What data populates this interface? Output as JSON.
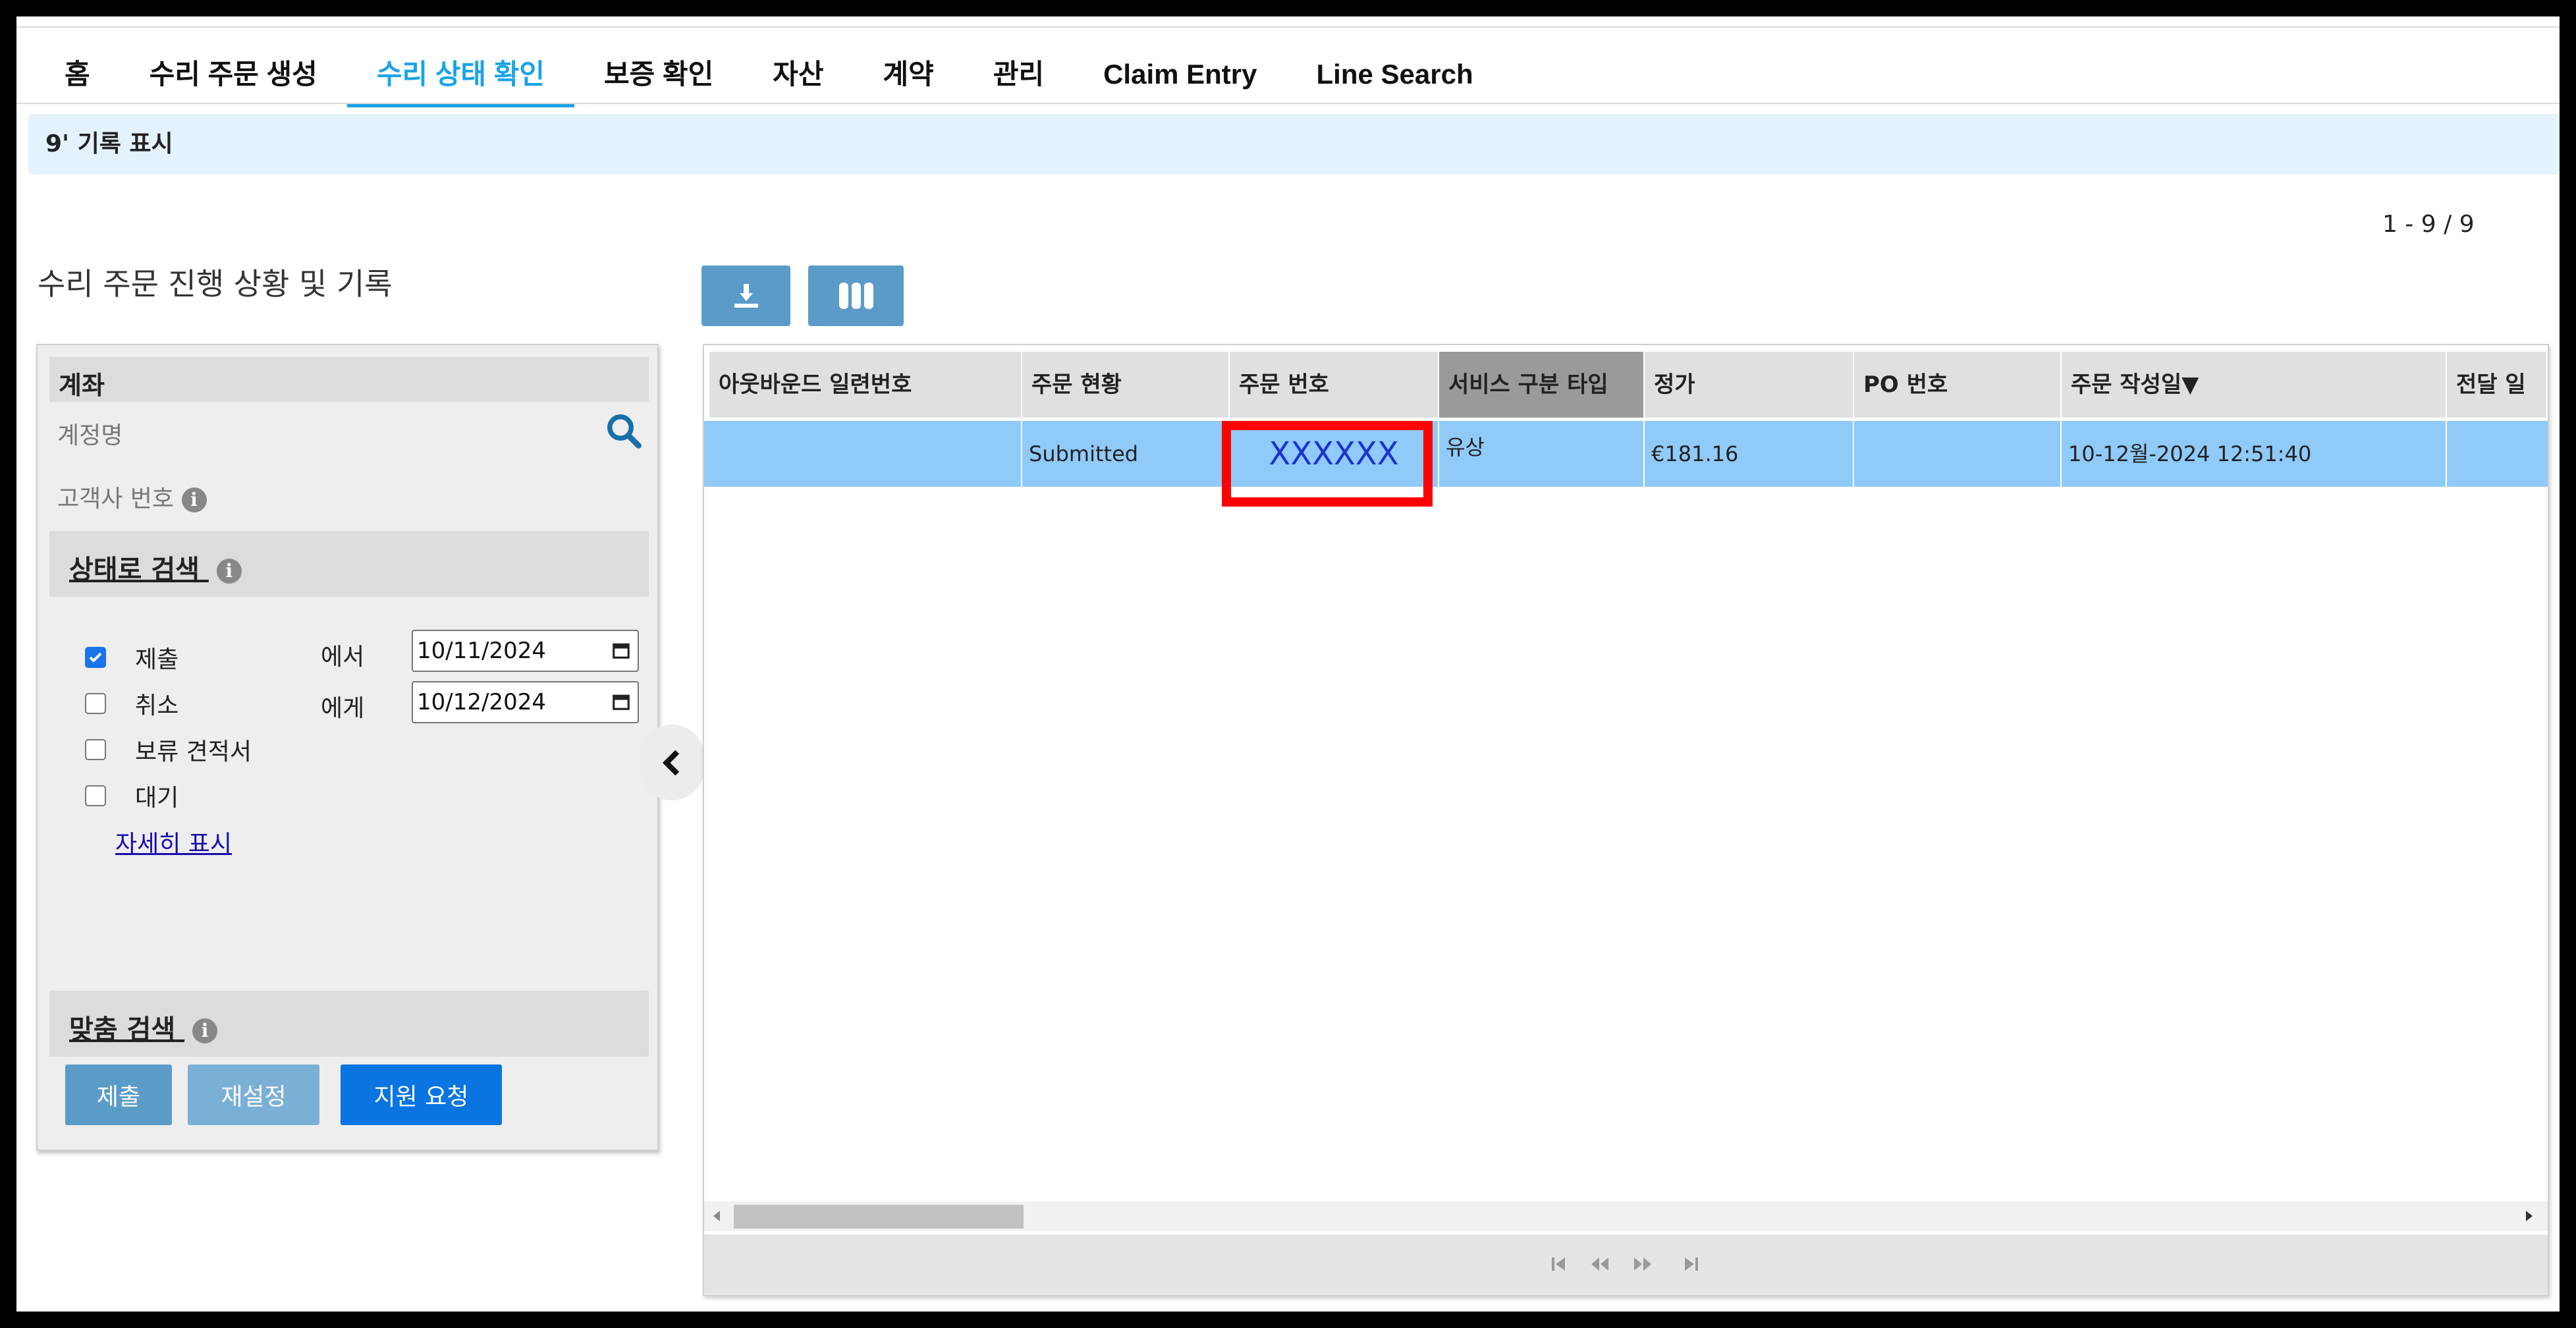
{
  "nav": {
    "tabs": [
      {
        "label": "홈"
      },
      {
        "label": "수리 주문 생성"
      },
      {
        "label": "수리 상태 확인"
      },
      {
        "label": "보증 확인"
      },
      {
        "label": "자산"
      },
      {
        "label": "계약"
      },
      {
        "label": "관리"
      },
      {
        "label": "Claim Entry"
      },
      {
        "label": "Line Search"
      }
    ],
    "active_tab": "수리 상태 확인"
  },
  "banner": {
    "text": "9' 기록 표시"
  },
  "record_count": "1 - 9 / 9",
  "panel_title": "수리 주문 진행 상황 및 기록",
  "filters": {
    "account_section": "계좌",
    "account_name_label": "계정명",
    "customer_number_label": "고객사 번호",
    "status_search_label": "상태로 검색",
    "statuses": [
      {
        "label": "제출",
        "checked": true
      },
      {
        "label": "취소",
        "checked": false
      },
      {
        "label": "보류 견적서",
        "checked": false
      },
      {
        "label": "대기",
        "checked": false
      }
    ],
    "from_label": "에서",
    "to_label": "에게",
    "from_date": "10/11/2024",
    "to_date": "10/12/2024",
    "more_link": "자세히 표시",
    "custom_search_label": "맞춤 검색",
    "submit_button": "제출",
    "reset_button": "재설정",
    "support_button": "지원 요청"
  },
  "table": {
    "columns": [
      "아웃바운드 일련번호",
      "주문 현황",
      "주문 번호",
      "서비스 구분 타입",
      "정가",
      "PO 번호",
      "주문 작성일▼",
      "전달 일"
    ],
    "sorted_column": "서비스 구분 타입",
    "rows": [
      {
        "outbound_serial": "",
        "status": "Submitted",
        "order_number": "XXXXXX",
        "service_type": "유상",
        "list_price": "€181.16",
        "po_number": "",
        "created": "10-12월-2024 12:51:40",
        "delivery": ""
      }
    ]
  },
  "colors": {
    "accent": "#1aa3e8",
    "selected_row": "#90caf9",
    "highlight_box": "#ff0000",
    "primary_button": "#0a74e0",
    "secondary_button": "#5b9bc8"
  },
  "icons": [
    "download-icon",
    "columns-icon",
    "search-icon",
    "info-icon",
    "calendar-icon",
    "chevron-left-icon",
    "first-page-icon",
    "prev-page-icon",
    "next-page-icon",
    "last-page-icon"
  ]
}
